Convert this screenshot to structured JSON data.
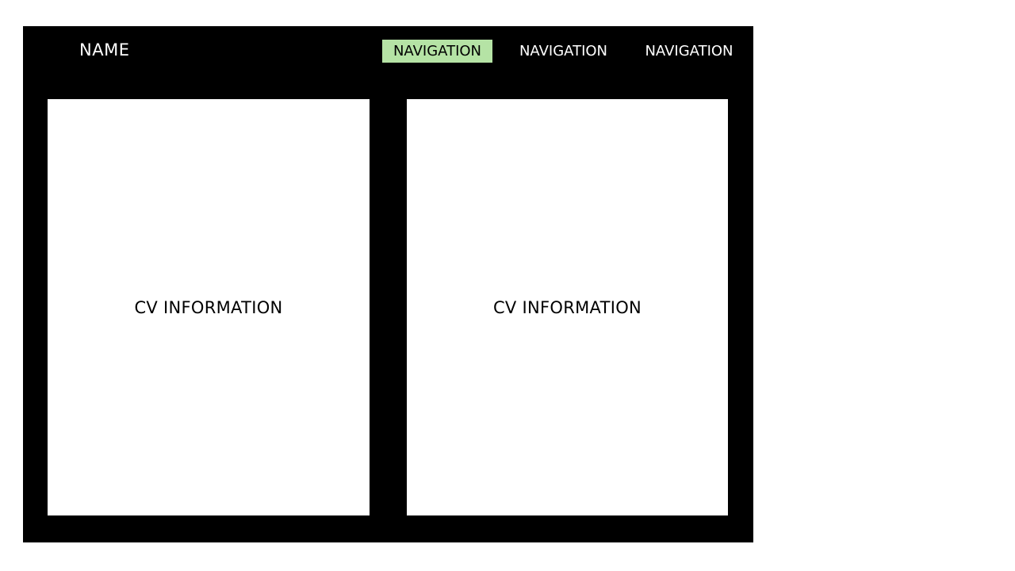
{
  "header": {
    "name": "NAME"
  },
  "nav": {
    "items": [
      {
        "label": "NAVIGATION",
        "active": true
      },
      {
        "label": "NAVIGATION",
        "active": false
      },
      {
        "label": "NAVIGATION",
        "active": false
      }
    ],
    "active_color": "#b5e3a5"
  },
  "main": {
    "panels": [
      {
        "text": "CV INFORMATION"
      },
      {
        "text": "CV INFORMATION"
      }
    ]
  },
  "colors": {
    "frame": "#000000",
    "panel": "#ffffff"
  }
}
